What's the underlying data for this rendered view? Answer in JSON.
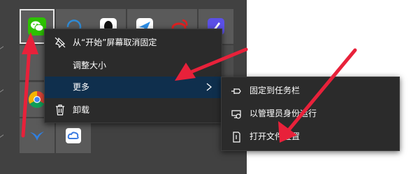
{
  "context_menu": {
    "items": [
      {
        "label": "从“开始”屏幕取消固定",
        "icon": "unpin-icon"
      },
      {
        "label": "调整大小",
        "icon": ""
      },
      {
        "label": "更多",
        "icon": "",
        "has_submenu": true
      },
      {
        "label": "卸载",
        "icon": "trash-icon"
      }
    ]
  },
  "submenu": {
    "items": [
      {
        "label": "固定到任务栏",
        "icon": "pin-icon"
      },
      {
        "label": "以管理员身份运行",
        "icon": "shield-icon"
      },
      {
        "label": "打开文件位置",
        "icon": "folder-file-icon"
      }
    ]
  },
  "tiles": [
    {
      "name": "wechat-tile",
      "icon": "wechat-icon",
      "accent": "#2dc100"
    },
    {
      "name": "edge-tile",
      "icon": "edge-icon",
      "accent": "#2f8bd6"
    },
    {
      "name": "qq-tile",
      "icon": "qq-icon",
      "accent": "#111111"
    },
    {
      "name": "feishu-tile",
      "icon": "paper-plane-icon",
      "accent": "#2e8fe8"
    },
    {
      "name": "weibo-tile",
      "icon": "weibo-icon",
      "accent": "#e02020"
    },
    {
      "name": "pen-app-tile",
      "icon": "pen-icon",
      "accent": "#5b50e6"
    },
    {
      "name": "chrome-tile",
      "icon": "chrome-icon",
      "accent": "#db4437"
    },
    {
      "name": "bird-app-tile",
      "icon": "bird-icon",
      "accent": "#2f7fe0"
    },
    {
      "name": "drive-app-tile",
      "icon": "cloud-icon",
      "accent": "#3b7be0"
    }
  ],
  "colors": {
    "panel": "#414141",
    "menu": "#2b2b2b",
    "active": "#0f2f4d",
    "arrow": "#e8213a"
  }
}
